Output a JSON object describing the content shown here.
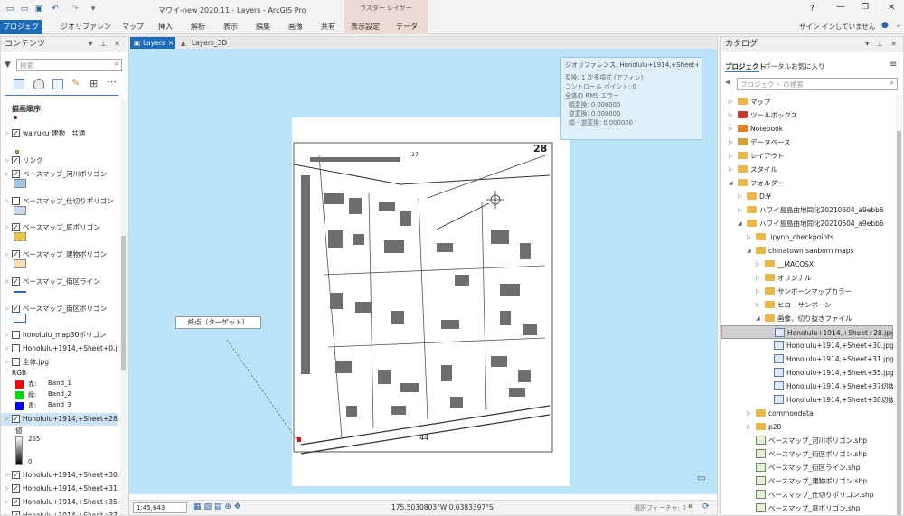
{
  "app": {
    "title": "マワイ-new 2020.11 - Layers - ArcGIS Pro",
    "context_group": "ラスター レイヤー",
    "help": "?",
    "user": "サイン インしていません"
  },
  "ribbon": {
    "tabs": [
      "プロジェクト",
      "ジオリファレンス",
      "マップ",
      "挿入",
      "解析",
      "表示",
      "編集",
      "画像",
      "共有",
      "表示設定",
      "データ"
    ]
  },
  "contents": {
    "title": "コンテンツ",
    "search_placeholder": "検索",
    "section": "描画順序",
    "layers": [
      {
        "label": "wairuku 建物　共通",
        "checked": true,
        "expand": true
      },
      {
        "label": "リンク",
        "checked": true,
        "expand": true
      },
      {
        "label": "ベースマップ_河川ポリゴン",
        "checked": true,
        "expand": true
      },
      {
        "label": "ベースマップ_仕切りポリゴン",
        "checked": false,
        "expand": true
      },
      {
        "label": "ベースマップ_庭ポリゴン",
        "checked": true,
        "expand": true
      },
      {
        "label": "ベースマップ_建物ポリゴン",
        "checked": true,
        "expand": true
      },
      {
        "label": "ベースマップ_街区ライン",
        "checked": true,
        "expand": true
      },
      {
        "label": "ベースマップ_街区ポリゴン",
        "checked": true,
        "expand": true
      },
      {
        "label": "honolulu_map30ポリゴン",
        "checked": false,
        "expand": true
      },
      {
        "label": "Honolulu+1914,+Sheet+0.jpg",
        "checked": false,
        "expand": true
      },
      {
        "label": "全体.jpg",
        "checked": false,
        "expand": true
      },
      {
        "label": "Honolulu+1914,+Sheet+28.jpg",
        "checked": true,
        "expand": true
      },
      {
        "label": "Honolulu+1914,+Sheet+30.jpg",
        "checked": true,
        "expand": true
      },
      {
        "label": "Honolulu+1914,+Sheet+31.jpg",
        "checked": true,
        "expand": true
      },
      {
        "label": "Honolulu+1914,+Sheet+35.jpg",
        "checked": true,
        "expand": true
      },
      {
        "label": "Honolulu+1914,+Sheet+37切抜",
        "checked": true,
        "expand": true
      }
    ],
    "rgb": {
      "title": "RGB",
      "bands": [
        {
          "label": "赤:",
          "band": "Band_1",
          "color": "#ff0000"
        },
        {
          "label": "緑:",
          "band": "Band_2",
          "color": "#00dd00"
        },
        {
          "label": "青:",
          "band": "Band_3",
          "color": "#0000ff"
        }
      ]
    },
    "stretch": {
      "title": "値",
      "max": "255",
      "min": "0"
    }
  },
  "map": {
    "tabs": [
      "Layers",
      "Layers_3D"
    ],
    "georef_info": {
      "title": "ジオリファレンス: Honolulu+1914,+Sheet+28.jpg",
      "lines": [
        "変換: 1 次多項式 (アフィン)",
        "コントロール ポイント: 0",
        "全体の RMS エラー",
        "順変換: 0.000000",
        "逆変換: 0.000000",
        "順 - 逆変換: 0.000000"
      ]
    },
    "callout": "終点（ターゲット）",
    "sheet_labels": {
      "number": "28",
      "bottom": "44",
      "top": "27"
    },
    "status": {
      "scale": "1:45,643",
      "coords": "175.5030803°W 0.0383397°S",
      "selected": "選択フィーチャ: 0"
    },
    "accent": "#1e6bb8",
    "water": "#b9e3f7"
  },
  "catalog": {
    "title": "カタログ",
    "tabs": [
      "プロジェクト",
      "ポータル",
      "お気に入り"
    ],
    "search_placeholder": "プロジェクト の検索",
    "items": [
      {
        "label": "マップ",
        "indent": 0,
        "icon": "map"
      },
      {
        "label": "ツールボックス",
        "indent": 0,
        "icon": "toolbox"
      },
      {
        "label": "Notebook",
        "indent": 0,
        "icon": "notebook"
      },
      {
        "label": "データベース",
        "indent": 0,
        "icon": "database"
      },
      {
        "label": "レイアウト",
        "indent": 0,
        "icon": "layout"
      },
      {
        "label": "スタイル",
        "indent": 0,
        "icon": "style"
      },
      {
        "label": "フォルダー",
        "indent": 0,
        "icon": "folder"
      },
      {
        "label": "D:¥",
        "indent": 1,
        "icon": "folder"
      },
      {
        "label": "ハワイ島島由地同化20210604_a9ebb6",
        "indent": 1,
        "icon": "folder"
      },
      {
        "label": "ハワイ島島由地同化20210604_a9ebb6",
        "indent": 1,
        "icon": "folder"
      },
      {
        "label": ".ipynb_checkpoints",
        "indent": 2,
        "icon": "folder"
      },
      {
        "label": "chinatown sanborn maps",
        "indent": 2,
        "icon": "folder"
      },
      {
        "label": "__MACOSX",
        "indent": 3,
        "icon": "folder"
      },
      {
        "label": "オリジナル",
        "indent": 3,
        "icon": "folder"
      },
      {
        "label": "サンボーンマップカラー",
        "indent": 3,
        "icon": "folder"
      },
      {
        "label": "ヒロ　サンボーン",
        "indent": 3,
        "icon": "folder"
      },
      {
        "label": "画像、切り抜きファイル",
        "indent": 3,
        "icon": "folder"
      },
      {
        "label": "Honolulu+1914,+Sheet+28.jpg",
        "indent": 4,
        "icon": "raster",
        "selected": true
      },
      {
        "label": "Honolulu+1914,+Sheet+30.jpg",
        "indent": 4,
        "icon": "raster"
      },
      {
        "label": "Honolulu+1914,+Sheet+31.jpg",
        "indent": 4,
        "icon": "raster"
      },
      {
        "label": "Honolulu+1914,+Sheet+35.jpg",
        "indent": 4,
        "icon": "raster"
      },
      {
        "label": "Honolulu+1914,+Sheet+37切抜き.jp",
        "indent": 4,
        "icon": "raster"
      },
      {
        "label": "Honolulu+1914,+Sheet+38切抜き",
        "indent": 4,
        "icon": "raster"
      },
      {
        "label": "commondata",
        "indent": 2,
        "icon": "folder"
      },
      {
        "label": "p20",
        "indent": 2,
        "icon": "folder"
      },
      {
        "label": "ベースマップ_河川ポリゴン.shp",
        "indent": 2,
        "icon": "shp"
      },
      {
        "label": "ベースマップ_街区ポリゴン.shp",
        "indent": 2,
        "icon": "shp"
      },
      {
        "label": "ベースマップ_街区ライン.shp",
        "indent": 2,
        "icon": "shp"
      },
      {
        "label": "ベースマップ_建物ポリゴン.shp",
        "indent": 2,
        "icon": "shp"
      },
      {
        "label": "ベースマップ_仕切りポリゴン.shp",
        "indent": 2,
        "icon": "shp"
      },
      {
        "label": "ベースマップ_庭ポリゴン.shp",
        "indent": 2,
        "icon": "shp"
      }
    ]
  }
}
